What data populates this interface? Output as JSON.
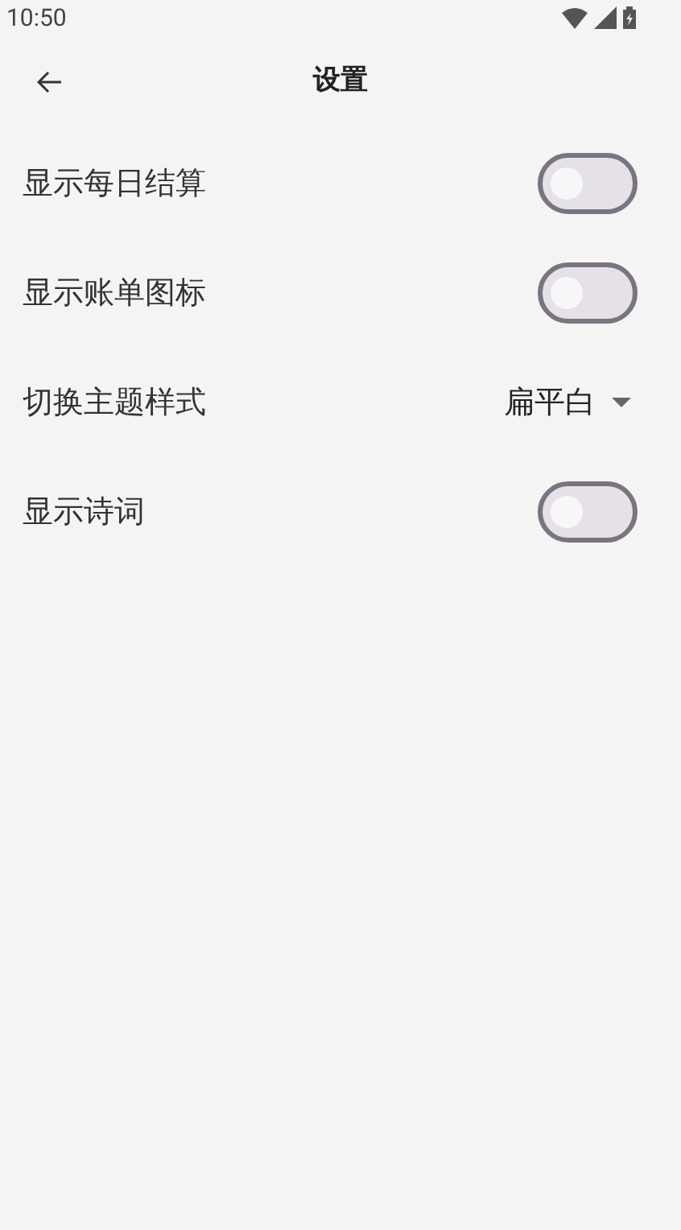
{
  "status_bar": {
    "time": "10:50"
  },
  "app_bar": {
    "title": "设置"
  },
  "settings": [
    {
      "kind": "switch",
      "label": "显示每日结算",
      "on": false
    },
    {
      "kind": "switch",
      "label": "显示账单图标",
      "on": false
    },
    {
      "kind": "dropdown",
      "label": "切换主题样式",
      "value": "扁平白"
    },
    {
      "kind": "switch",
      "label": "显示诗词",
      "on": false
    }
  ]
}
